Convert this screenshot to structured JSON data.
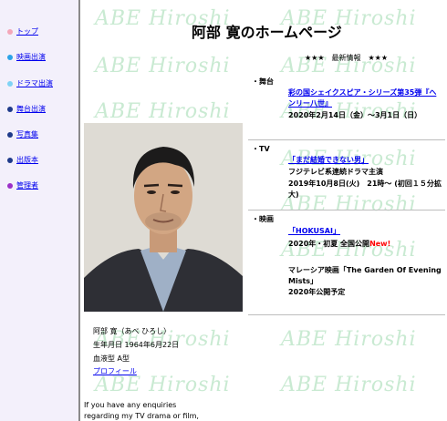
{
  "nav": {
    "items": [
      {
        "label": "トップ",
        "color": "#f4a7b9"
      },
      {
        "label": "映画出演",
        "color": "#2ba3e8"
      },
      {
        "label": "ドラマ出演",
        "color": "#7fd3f5"
      },
      {
        "label": "舞台出演",
        "color": "#1e3a8a"
      },
      {
        "label": "写真集",
        "color": "#1e3a8a"
      },
      {
        "label": "出版本",
        "color": "#1e3a8a"
      },
      {
        "label": "管理者",
        "color": "#9b2fc8"
      }
    ]
  },
  "watermark": "ABE Hiroshi",
  "title": "阿部 寛のホームページ",
  "news_heading": "★★★　最新情報　★★★",
  "profile": {
    "name": "阿部 寛（あべ ひろし）",
    "birthday": "生年月日 1964年6月22日",
    "blood": "血液型 A型",
    "link": "プロフィール"
  },
  "contact": {
    "line1": "If you have any enquiries",
    "line2": "regarding my TV drama or film,"
  },
  "sections": {
    "stage": {
      "label": "・舞台",
      "link": "彩の国シェイクスピア・シリーズ第35弾『ヘンリー八世』",
      "date": "2020年2月14日（金）～3月1日（日）"
    },
    "tv": {
      "label": "・TV",
      "link": "「まだ結婚できない男」",
      "broadcaster": "フジテレビ系連続ドラマ主演",
      "date": "2019年10月8日(火)　21時～ (初回１５分拡大)"
    },
    "film": {
      "label": "・映画",
      "link": "「HOKUSAI」",
      "release": "2020年・初夏 全国公開",
      "new_badge": "New!",
      "film2_line1": "マレーシア映画「The Garden Of Evening",
      "film2_line2": "Mists」",
      "film2_release": "2020年公開予定"
    }
  }
}
